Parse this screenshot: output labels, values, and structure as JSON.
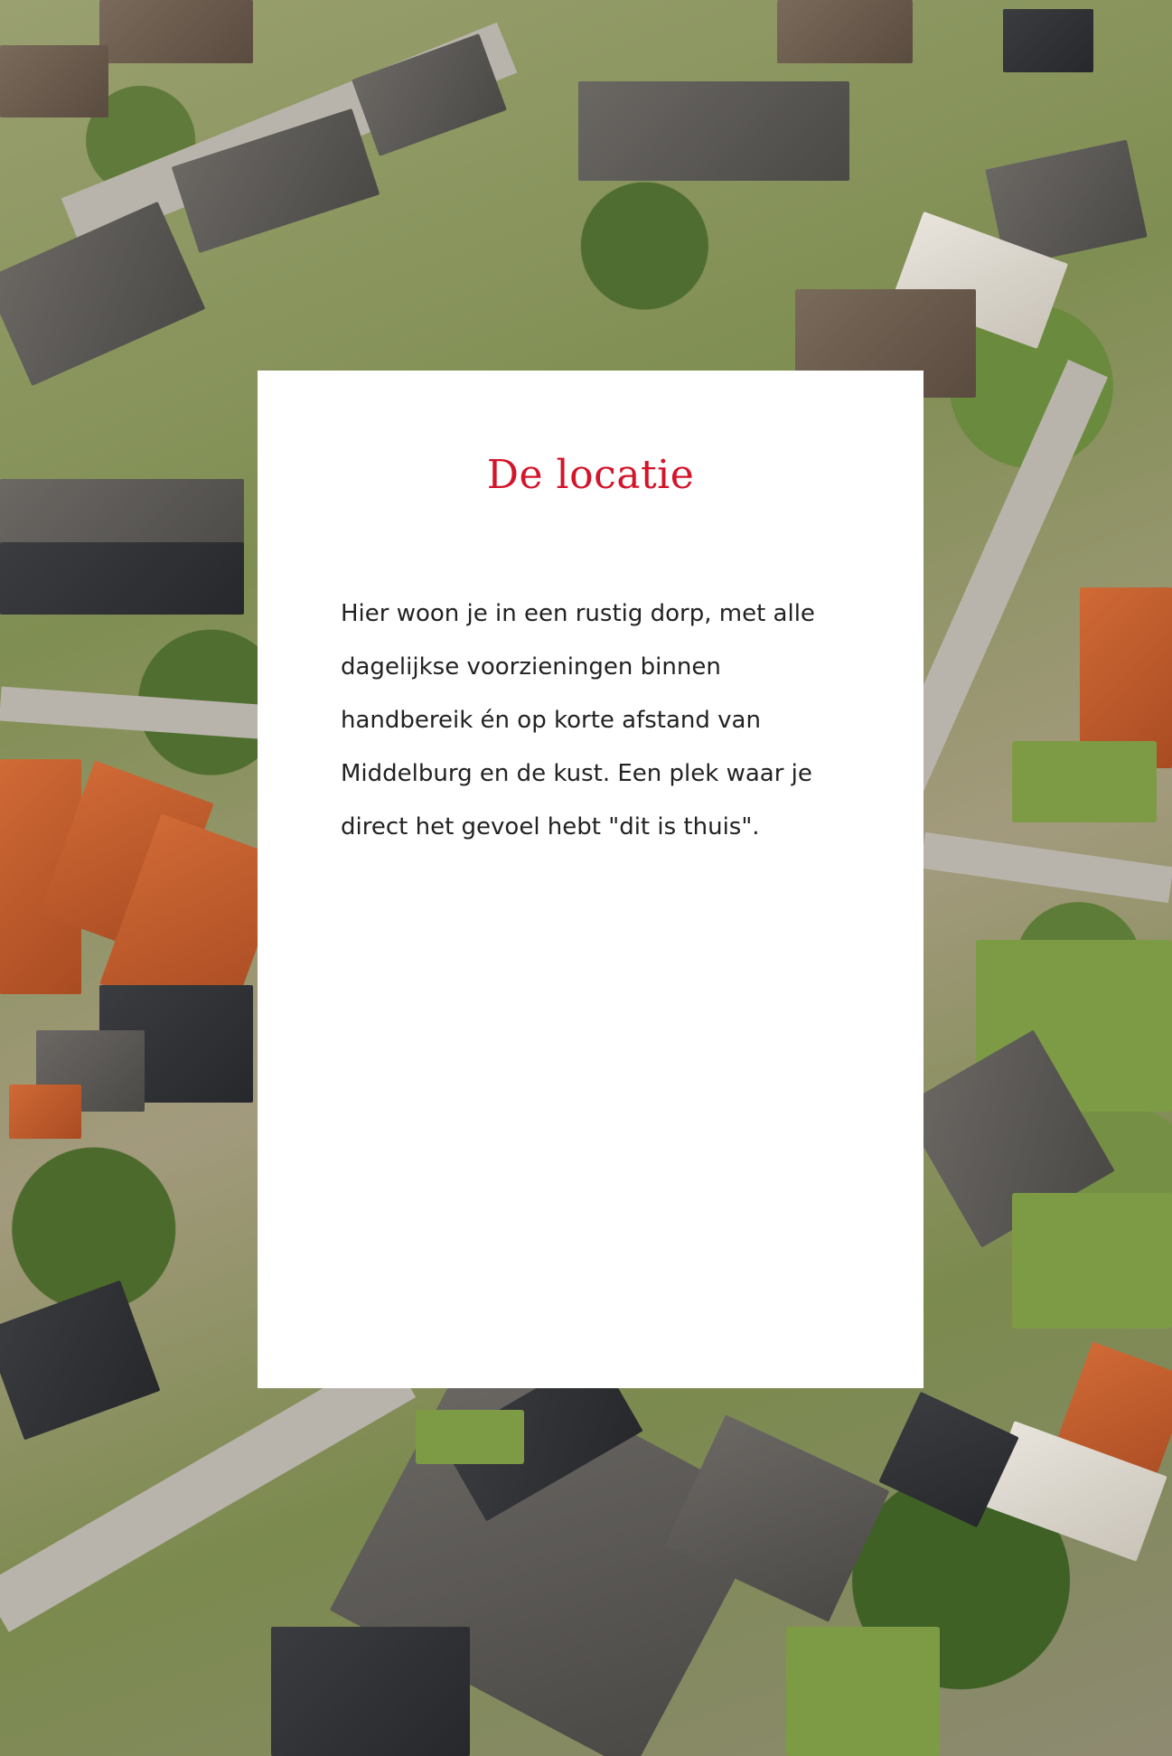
{
  "section": {
    "title": "De locatie",
    "body": "Hier woon je in een rustig dorp, met alle dagelijkse voorzieningen binnen handbereik én op korte afstand van Middelburg en de kust. Een plek waar je direct het gevoel hebt \"dit is thuis\"."
  },
  "colors": {
    "title_accent": "#d4142a",
    "card_background": "#ffffff",
    "body_text": "#222222"
  }
}
